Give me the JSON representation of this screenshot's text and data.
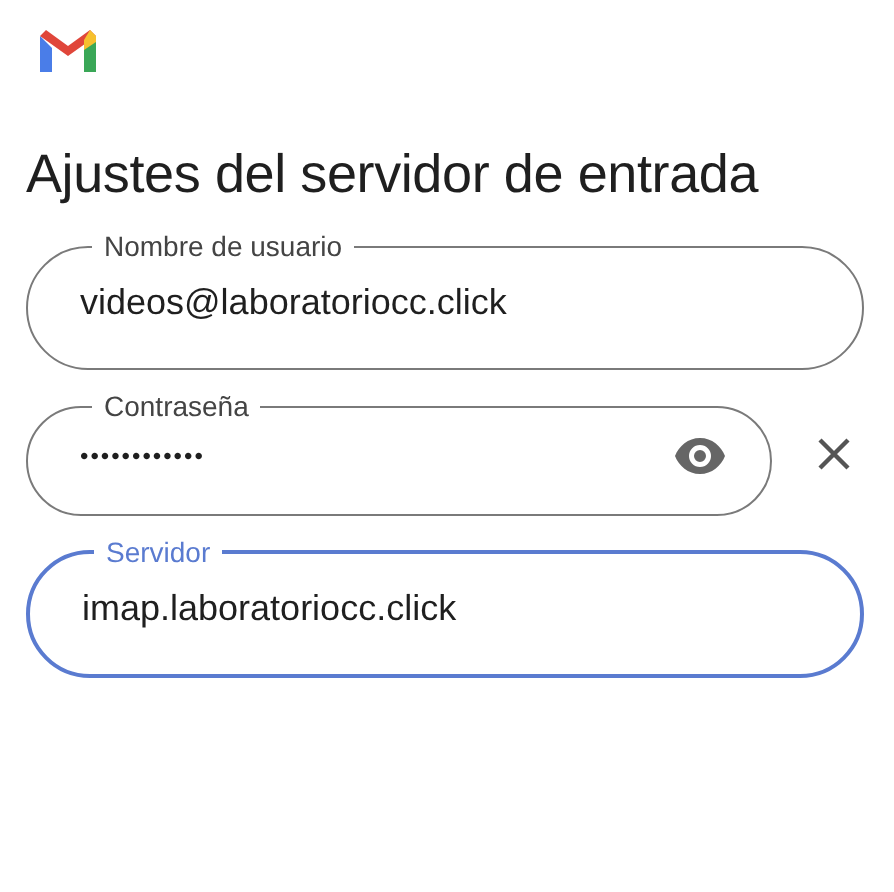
{
  "title": "Ajustes del servidor de entrada",
  "fields": [
    {
      "kind": "text",
      "label": "Nombre de usuario",
      "value": "videos@laboratoriocc.click",
      "focused": false
    },
    {
      "kind": "password",
      "label": "Contraseña",
      "value": "••••••••••••",
      "focused": false
    },
    {
      "kind": "text",
      "label": "Servidor",
      "value": "imap.laboratoriocc.click",
      "focused": true
    }
  ]
}
